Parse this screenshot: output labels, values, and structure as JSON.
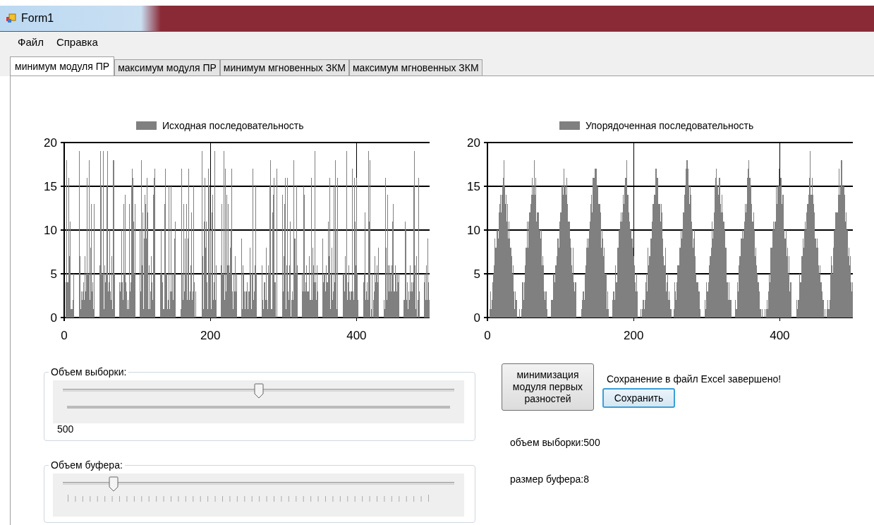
{
  "window": {
    "title": "Form1"
  },
  "menu": [
    {
      "label": "Файл"
    },
    {
      "label": "Справка"
    }
  ],
  "tabs": [
    {
      "label": "минимум модуля ПР",
      "selected": true
    },
    {
      "label": "максимум модуля ПР",
      "selected": false
    },
    {
      "label": "минимум мгновенных ЗКМ",
      "selected": false
    },
    {
      "label": "максимум мгновенных ЗКМ",
      "selected": false
    }
  ],
  "charts": [
    {
      "legend": "Исходная последовательность",
      "kind": "noise",
      "yticks": [
        "20",
        "15",
        "10",
        "5",
        "0"
      ],
      "xticks": [
        "0",
        "200",
        "400"
      ]
    },
    {
      "legend": "Упорядоченная последовательность",
      "kind": "sawtooth",
      "yticks": [
        "20",
        "15",
        "10",
        "5",
        "0"
      ],
      "xticks": [
        "0",
        "200",
        "400"
      ]
    }
  ],
  "sliders": [
    {
      "label": "Объем выборки:",
      "kind": "solid",
      "level": 0.5,
      "value": "500"
    },
    {
      "label": "Объем буфера:",
      "kind": "ticks",
      "level": 0.13
    }
  ],
  "run_button": "минимизация модуля первых разностей",
  "status": "Сохранение в файл Excel завершено!",
  "save_button": "Сохранить",
  "info": [
    "объем выборки:500",
    "размер буфера:8"
  ]
}
